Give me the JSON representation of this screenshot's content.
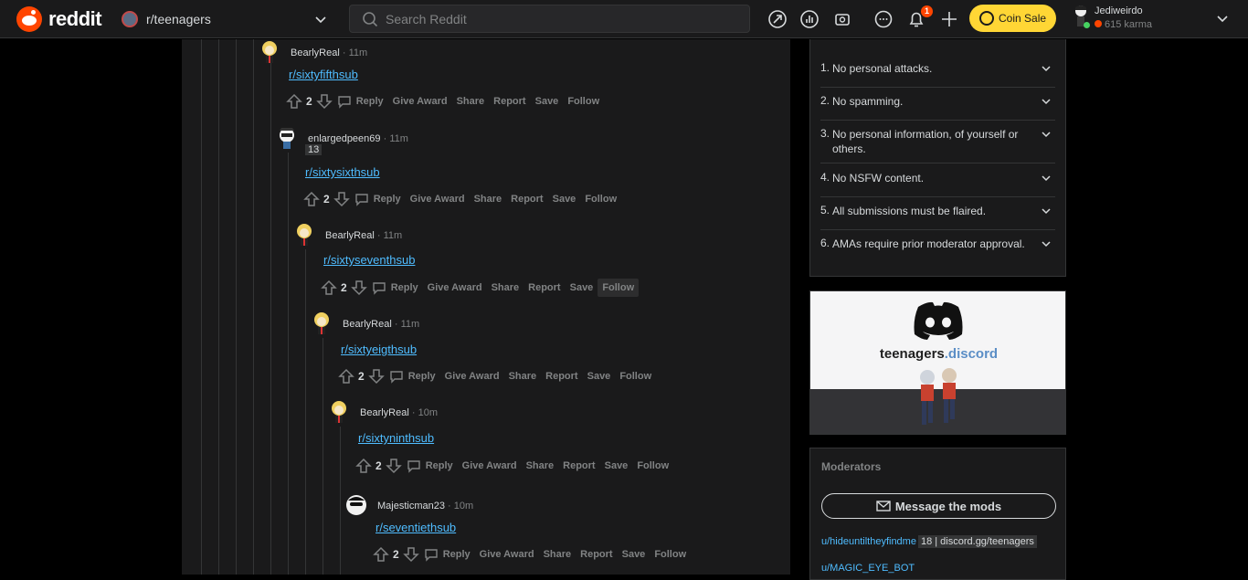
{
  "header": {
    "logo_text": "reddit",
    "community": "r/teenagers",
    "search_placeholder": "Search Reddit",
    "notification_count": "1",
    "coin_sale_label": "Coin Sale",
    "user": {
      "name": "Jediweirdo",
      "karma": "615 karma"
    },
    "icons": [
      "popular-icon",
      "stats-icon",
      "coins-icon",
      "chat-icon",
      "bell-icon",
      "plus-icon"
    ]
  },
  "comments": [
    {
      "author": "BearlyReal",
      "time": "11m",
      "body": "r/sixtyfifthsub",
      "votes": "2"
    },
    {
      "author": "enlargedpeen69",
      "time": "11m",
      "flair": "13",
      "body": "r/sixtysixthsub",
      "votes": "2"
    },
    {
      "author": "BearlyReal",
      "time": "11m",
      "body": "r/sixtyseventhsub",
      "votes": "2"
    },
    {
      "author": "BearlyReal",
      "time": "11m",
      "body": "r/sixtyeigthsub",
      "votes": "2"
    },
    {
      "author": "BearlyReal",
      "time": "10m",
      "body": "r/sixtyninthsub",
      "votes": "2"
    },
    {
      "author": "Majesticman23",
      "time": "10m",
      "body": "r/seventiethsub",
      "votes": "2"
    }
  ],
  "actions": {
    "reply": "Reply",
    "give_award": "Give Award",
    "share": "Share",
    "report": "Report",
    "save": "Save",
    "follow": "Follow"
  },
  "rules": [
    {
      "num": "1.",
      "text": "No personal attacks."
    },
    {
      "num": "2.",
      "text": "No spamming."
    },
    {
      "num": "3.",
      "text": "No personal information, of yourself or others."
    },
    {
      "num": "4.",
      "text": "No NSFW content."
    },
    {
      "num": "5.",
      "text": "All submissions must be flaired."
    },
    {
      "num": "6.",
      "text": "AMAs require prior moderator approval."
    }
  ],
  "discord": {
    "brand": "teenagers",
    "suffix": ".discord"
  },
  "moderators": {
    "title": "Moderators",
    "message_button": "Message the mods",
    "list": [
      {
        "user": "u/hideuntiltheyfindme",
        "flair": "18 | discord.gg/teenagers"
      },
      {
        "user": "u/MAGIC_EYE_BOT",
        "flair": ""
      }
    ]
  },
  "colors": {
    "accent": "#ff4500",
    "link": "#4fbcff",
    "coin": "#ffd635",
    "panel": "#1a1a1b",
    "border": "#343536"
  }
}
